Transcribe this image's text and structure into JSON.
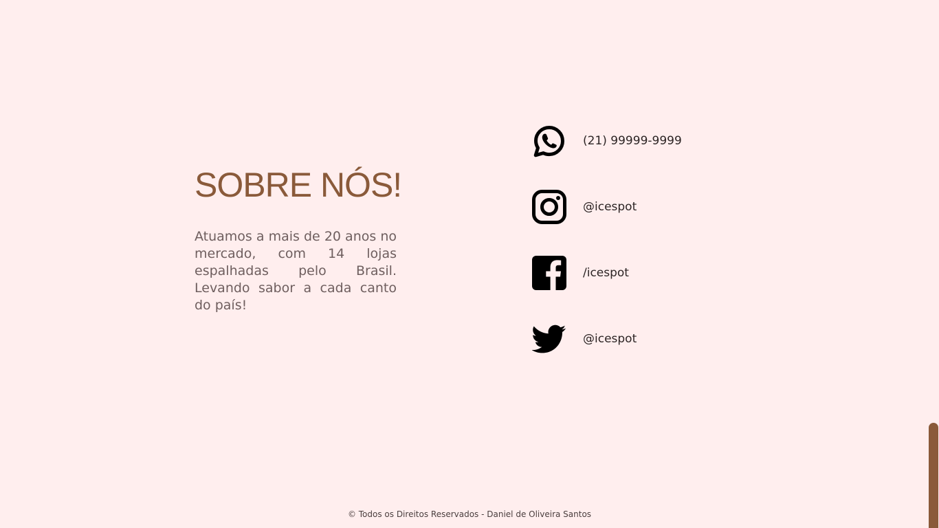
{
  "about": {
    "title": "SOBRE NÓS!",
    "text": "Atuamos a mais de 20 anos no mercado, com 14 lojas espalhadas pelo Brasil. Levando sabor a cada canto do país!"
  },
  "contacts": [
    {
      "icon": "whatsapp-icon",
      "label": "(21) 99999-9999"
    },
    {
      "icon": "instagram-icon",
      "label": "@icespot"
    },
    {
      "icon": "facebook-icon",
      "label": "/icespot"
    },
    {
      "icon": "twitter-icon",
      "label": "@icespot"
    }
  ],
  "footer": {
    "text": "© Todos os Direitos Reservados - Daniel de Oliveira Santos"
  },
  "colors": {
    "background": "#FFEEEE",
    "accent": "#8A5A3A",
    "text": "#6E5E5E"
  }
}
